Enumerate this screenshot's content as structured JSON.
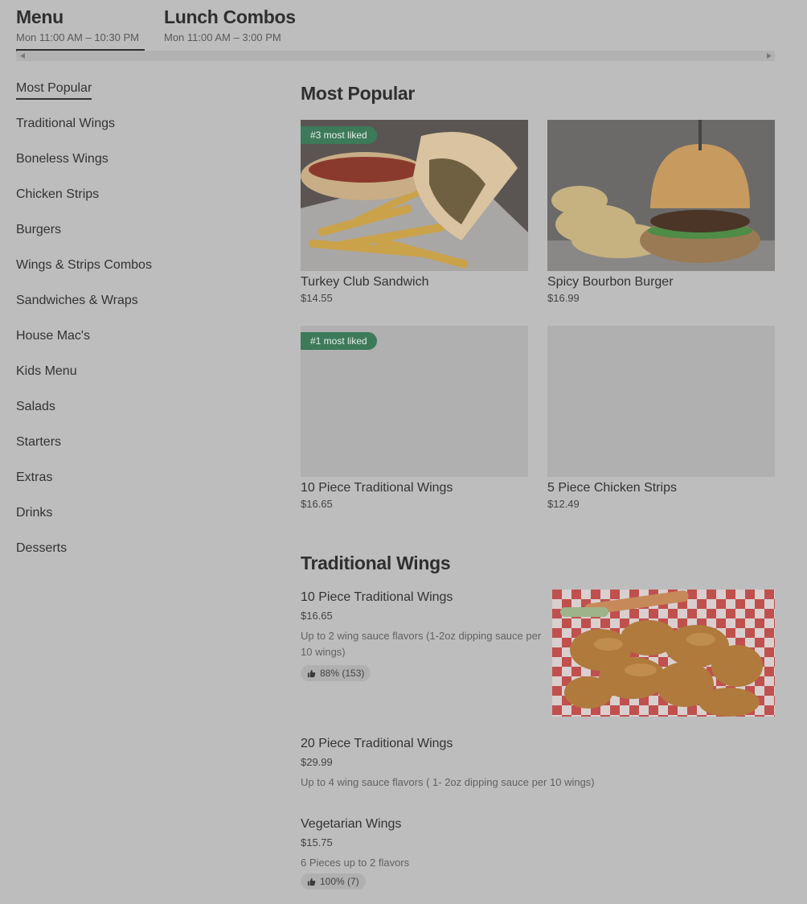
{
  "tabs": [
    {
      "title": "Menu",
      "hours": "Mon 11:00 AM – 10:30 PM"
    },
    {
      "title": "Lunch Combos",
      "hours": "Mon 11:00 AM – 3:00 PM"
    }
  ],
  "sidebar": {
    "items": [
      {
        "label": "Most Popular"
      },
      {
        "label": "Traditional Wings"
      },
      {
        "label": "Boneless Wings"
      },
      {
        "label": "Chicken Strips"
      },
      {
        "label": "Burgers"
      },
      {
        "label": "Wings & Strips Combos"
      },
      {
        "label": "Sandwiches & Wraps"
      },
      {
        "label": "House Mac's"
      },
      {
        "label": "Kids Menu"
      },
      {
        "label": "Salads"
      },
      {
        "label": "Starters"
      },
      {
        "label": "Extras"
      },
      {
        "label": "Drinks"
      },
      {
        "label": "Desserts"
      }
    ]
  },
  "popular": {
    "title": "Most Popular",
    "cards": [
      {
        "name": "Turkey Club Sandwich",
        "price": "$14.55",
        "badge": "#3 most liked"
      },
      {
        "name": "Spicy Bourbon Burger",
        "price": "$16.99",
        "badge": ""
      },
      {
        "name": "10 Piece Traditional Wings",
        "price": "$16.65",
        "badge": "#1 most liked"
      },
      {
        "name": "5 Piece Chicken Strips",
        "price": "$12.49",
        "badge": ""
      }
    ]
  },
  "wings": {
    "title": "Traditional Wings",
    "items": [
      {
        "name": "10 Piece Traditional Wings",
        "price": "$16.65",
        "desc": "Up to 2 wing sauce flavors (1-2oz dipping sauce per 10 wings)",
        "rating": "88% (153)"
      },
      {
        "name": "20 Piece Traditional Wings",
        "price": "$29.99",
        "desc": "Up to 4 wing sauce flavors ( 1- 2oz dipping sauce per 10 wings)",
        "rating": ""
      },
      {
        "name": "Vegetarian Wings",
        "price": "$15.75",
        "desc": "6 Pieces up to 2 flavors",
        "rating": "100% (7)"
      }
    ]
  },
  "colors": {
    "background": "#bdbdbd",
    "badge": "#3c7a59",
    "text": "#333333"
  }
}
